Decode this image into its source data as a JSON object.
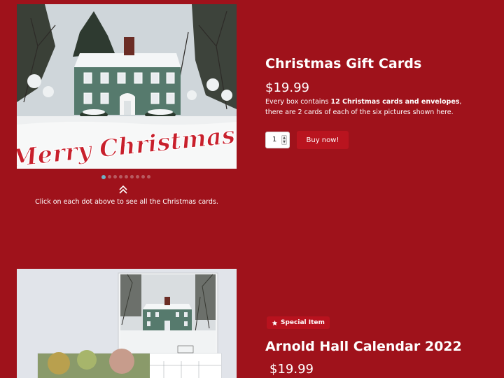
{
  "product1": {
    "image_text": "Merry Christmas",
    "carousel": {
      "count": 9,
      "active_index": 0
    },
    "caption": "Click on each dot above to see all the Christmas cards.",
    "title": "Christmas Gift Cards",
    "price": "$19.99",
    "description": {
      "prefix": "Every box contains ",
      "bold": "12 Christmas cards and envelopes",
      "suffix": ", there are 2 cards of each of the six pictures shown here."
    },
    "quantity": "1",
    "buy_label": "Buy now!"
  },
  "product2": {
    "badge_label": "Special Item",
    "title": "Arnold Hall Calendar 2022",
    "price": "$19.99"
  },
  "colors": {
    "background": "#9f121b",
    "button": "#b9141f",
    "dot_active": "#6fb2c6",
    "dot": "#b85a60"
  }
}
